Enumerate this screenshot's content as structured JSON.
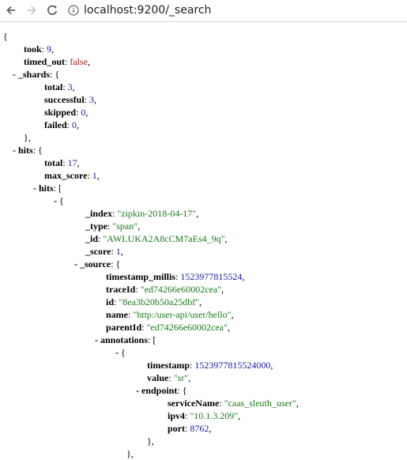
{
  "browser": {
    "url_host": "localhost",
    "url_path": ":9200/_search"
  },
  "json": {
    "open": "{",
    "took": "9",
    "timed_out": "false",
    "shards": {
      "total": "3",
      "successful": "3",
      "skipped": "0",
      "failed": "0"
    },
    "hits": {
      "total": "17",
      "max_score": "1",
      "index": "\"zipkin-2018-04-17\"",
      "type": "\"span\"",
      "id": "\"AWLUKA2A8cCM7aEs4_9q\"",
      "score": "1",
      "source": {
        "timestamp_millis": "1523977815524",
        "traceId": "\"ed74266e60002cea\"",
        "id": "\"8ea3b20b50a25dbf\"",
        "name": "\"http:/user-api/user/hello\"",
        "parentId": "\"ed74266e60002cea\"",
        "annotation": {
          "timestamp": "1523977815524000",
          "value": "\"sr\"",
          "endpoint": {
            "serviceName": "\"caas_sleuth_user\"",
            "ipv4": "\"10.1.3.209\"",
            "port": "8762"
          }
        }
      }
    }
  }
}
